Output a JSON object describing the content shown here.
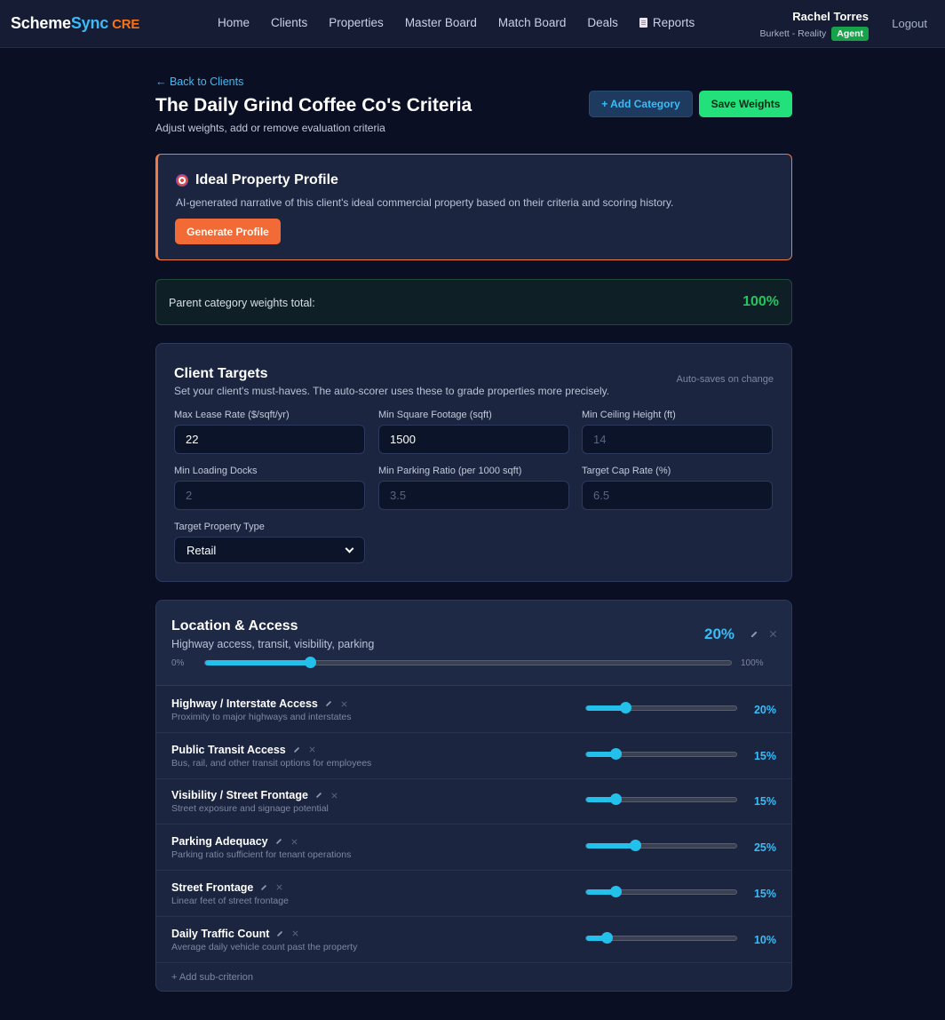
{
  "nav": {
    "brand_part1": "Scheme",
    "brand_part2": "Sync",
    "brand_part3": "CRE",
    "links": [
      "Home",
      "Clients",
      "Properties",
      "Master Board",
      "Match Board",
      "Deals",
      "Reports"
    ],
    "user_name": "Rachel Torres",
    "user_company": "Burkett - Reality",
    "user_role": "Agent",
    "logout": "Logout"
  },
  "header": {
    "back": "← Back to Clients",
    "title": "The Daily Grind Coffee Co's Criteria",
    "subtitle": "Adjust weights, add or remove evaluation criteria",
    "add_category": "+ Add Category",
    "save_weights": "Save Weights"
  },
  "profile": {
    "title": "Ideal Property Profile",
    "description": "AI-generated narrative of this client's ideal commercial property based on their criteria and scoring history.",
    "button": "Generate Profile"
  },
  "weights": {
    "label": "Parent category weights total:",
    "value": "100%"
  },
  "targets": {
    "title": "Client Targets",
    "description": "Set your client's must-haves. The auto-scorer uses these to grade properties more precisely.",
    "autosave": "Auto-saves on change",
    "fields": [
      {
        "label": "Max Lease Rate ($/sqft/yr)",
        "value": "22",
        "placeholder": ""
      },
      {
        "label": "Min Square Footage (sqft)",
        "value": "1500",
        "placeholder": ""
      },
      {
        "label": "Min Ceiling Height (ft)",
        "value": "",
        "placeholder": "14"
      },
      {
        "label": "Min Loading Docks",
        "value": "",
        "placeholder": "2"
      },
      {
        "label": "Min Parking Ratio (per 1000 sqft)",
        "value": "",
        "placeholder": "3.5"
      },
      {
        "label": "Target Cap Rate (%)",
        "value": "",
        "placeholder": "6.5"
      }
    ],
    "property_type_label": "Target Property Type",
    "property_type_value": "Retail"
  },
  "category": {
    "title": "Location & Access",
    "description": "Highway access, transit, visibility, parking",
    "weight": "20%",
    "weight_value": 0.2,
    "range_min": "0%",
    "range_max": "100%",
    "subcriteria": [
      {
        "name": "Highway / Interstate Access",
        "description": "Proximity to major highways and interstates",
        "weight": "20%",
        "value": 0.2
      },
      {
        "name": "Public Transit Access",
        "description": "Bus, rail, and other transit options for employees",
        "weight": "15%",
        "value": 0.15
      },
      {
        "name": "Visibility / Street Frontage",
        "description": "Street exposure and signage potential",
        "weight": "15%",
        "value": 0.15
      },
      {
        "name": "Parking Adequacy",
        "description": "Parking ratio sufficient for tenant operations",
        "weight": "25%",
        "value": 0.25
      },
      {
        "name": "Street Frontage",
        "description": "Linear feet of street frontage",
        "weight": "15%",
        "value": 0.15
      },
      {
        "name": "Daily Traffic Count",
        "description": "Average daily vehicle count past the property",
        "weight": "10%",
        "value": 0.1
      }
    ],
    "add_sub": "+ Add sub-criterion"
  },
  "colors": {
    "accent": "#38bdf8",
    "save": "#22e07a",
    "generate": "#f26b36",
    "weights_ok": "#22c55e"
  }
}
